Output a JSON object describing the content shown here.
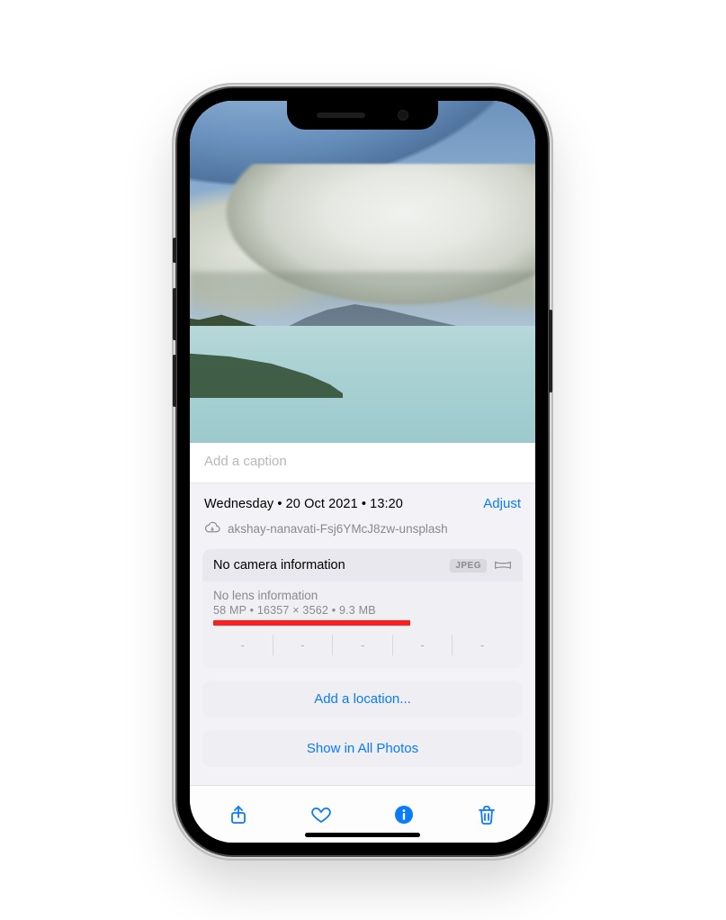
{
  "caption": {
    "placeholder": "Add a caption"
  },
  "meta": {
    "dateline": "Wednesday • 20 Oct 2021 • 13:20",
    "adjust_label": "Adjust",
    "filename": "akshay-nanavati-Fsj6YMcJ8zw-unsplash"
  },
  "card": {
    "camera_title": "No camera information",
    "format_badge": "JPEG",
    "lens_line": "No lens information",
    "spec_line": "58 MP  •  16357 × 3562  •  9.3 MB",
    "segments": [
      "-",
      "-",
      "-",
      "-",
      "-"
    ]
  },
  "actions": {
    "add_location": "Add a location...",
    "show_all": "Show in All Photos"
  },
  "colors": {
    "ios_blue": "#0a7aff",
    "annotation_red": "#ff1e1e"
  }
}
